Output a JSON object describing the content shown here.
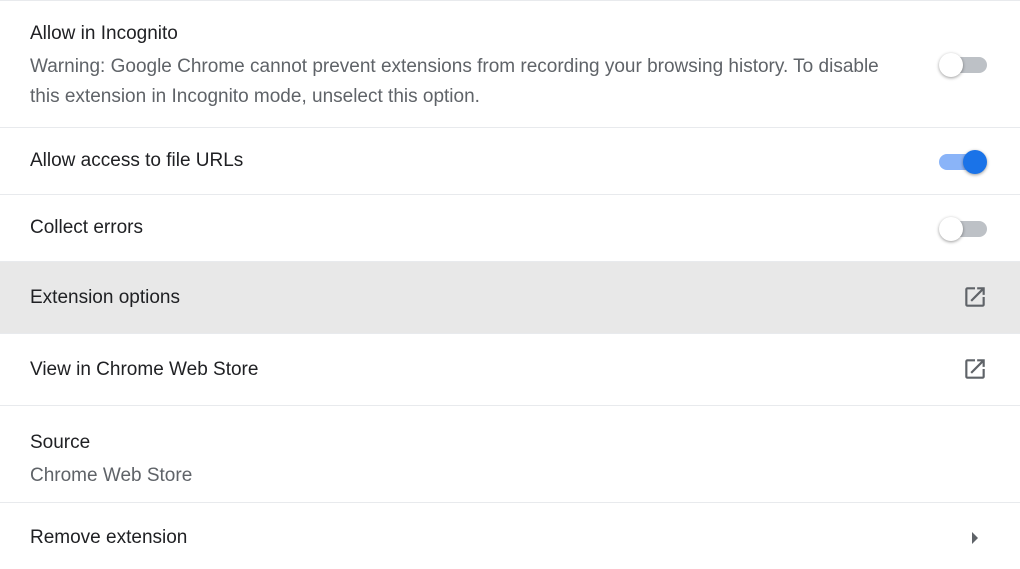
{
  "settings": {
    "incognito": {
      "label": "Allow in Incognito",
      "warning": "Warning: Google Chrome cannot prevent extensions from recording your browsing history. To disable this extension in Incognito mode, unselect this option.",
      "enabled": false
    },
    "file_urls": {
      "label": "Allow access to file URLs",
      "enabled": true
    },
    "collect_errors": {
      "label": "Collect errors",
      "enabled": false
    },
    "extension_options": {
      "label": "Extension options",
      "icon": "open-in-new-icon"
    },
    "web_store": {
      "label": "View in Chrome Web Store",
      "icon": "open-in-new-icon"
    },
    "source": {
      "label": "Source",
      "value": "Chrome Web Store"
    },
    "remove": {
      "label": "Remove extension",
      "icon": "chevron-right-icon"
    }
  },
  "colors": {
    "toggle_on_knob": "#1a73e8",
    "toggle_on_track": "#8ab4f8",
    "toggle_off_track": "#bdc1c6",
    "highlight_row": "#e8e8e8",
    "secondary_text": "#5f6368"
  }
}
